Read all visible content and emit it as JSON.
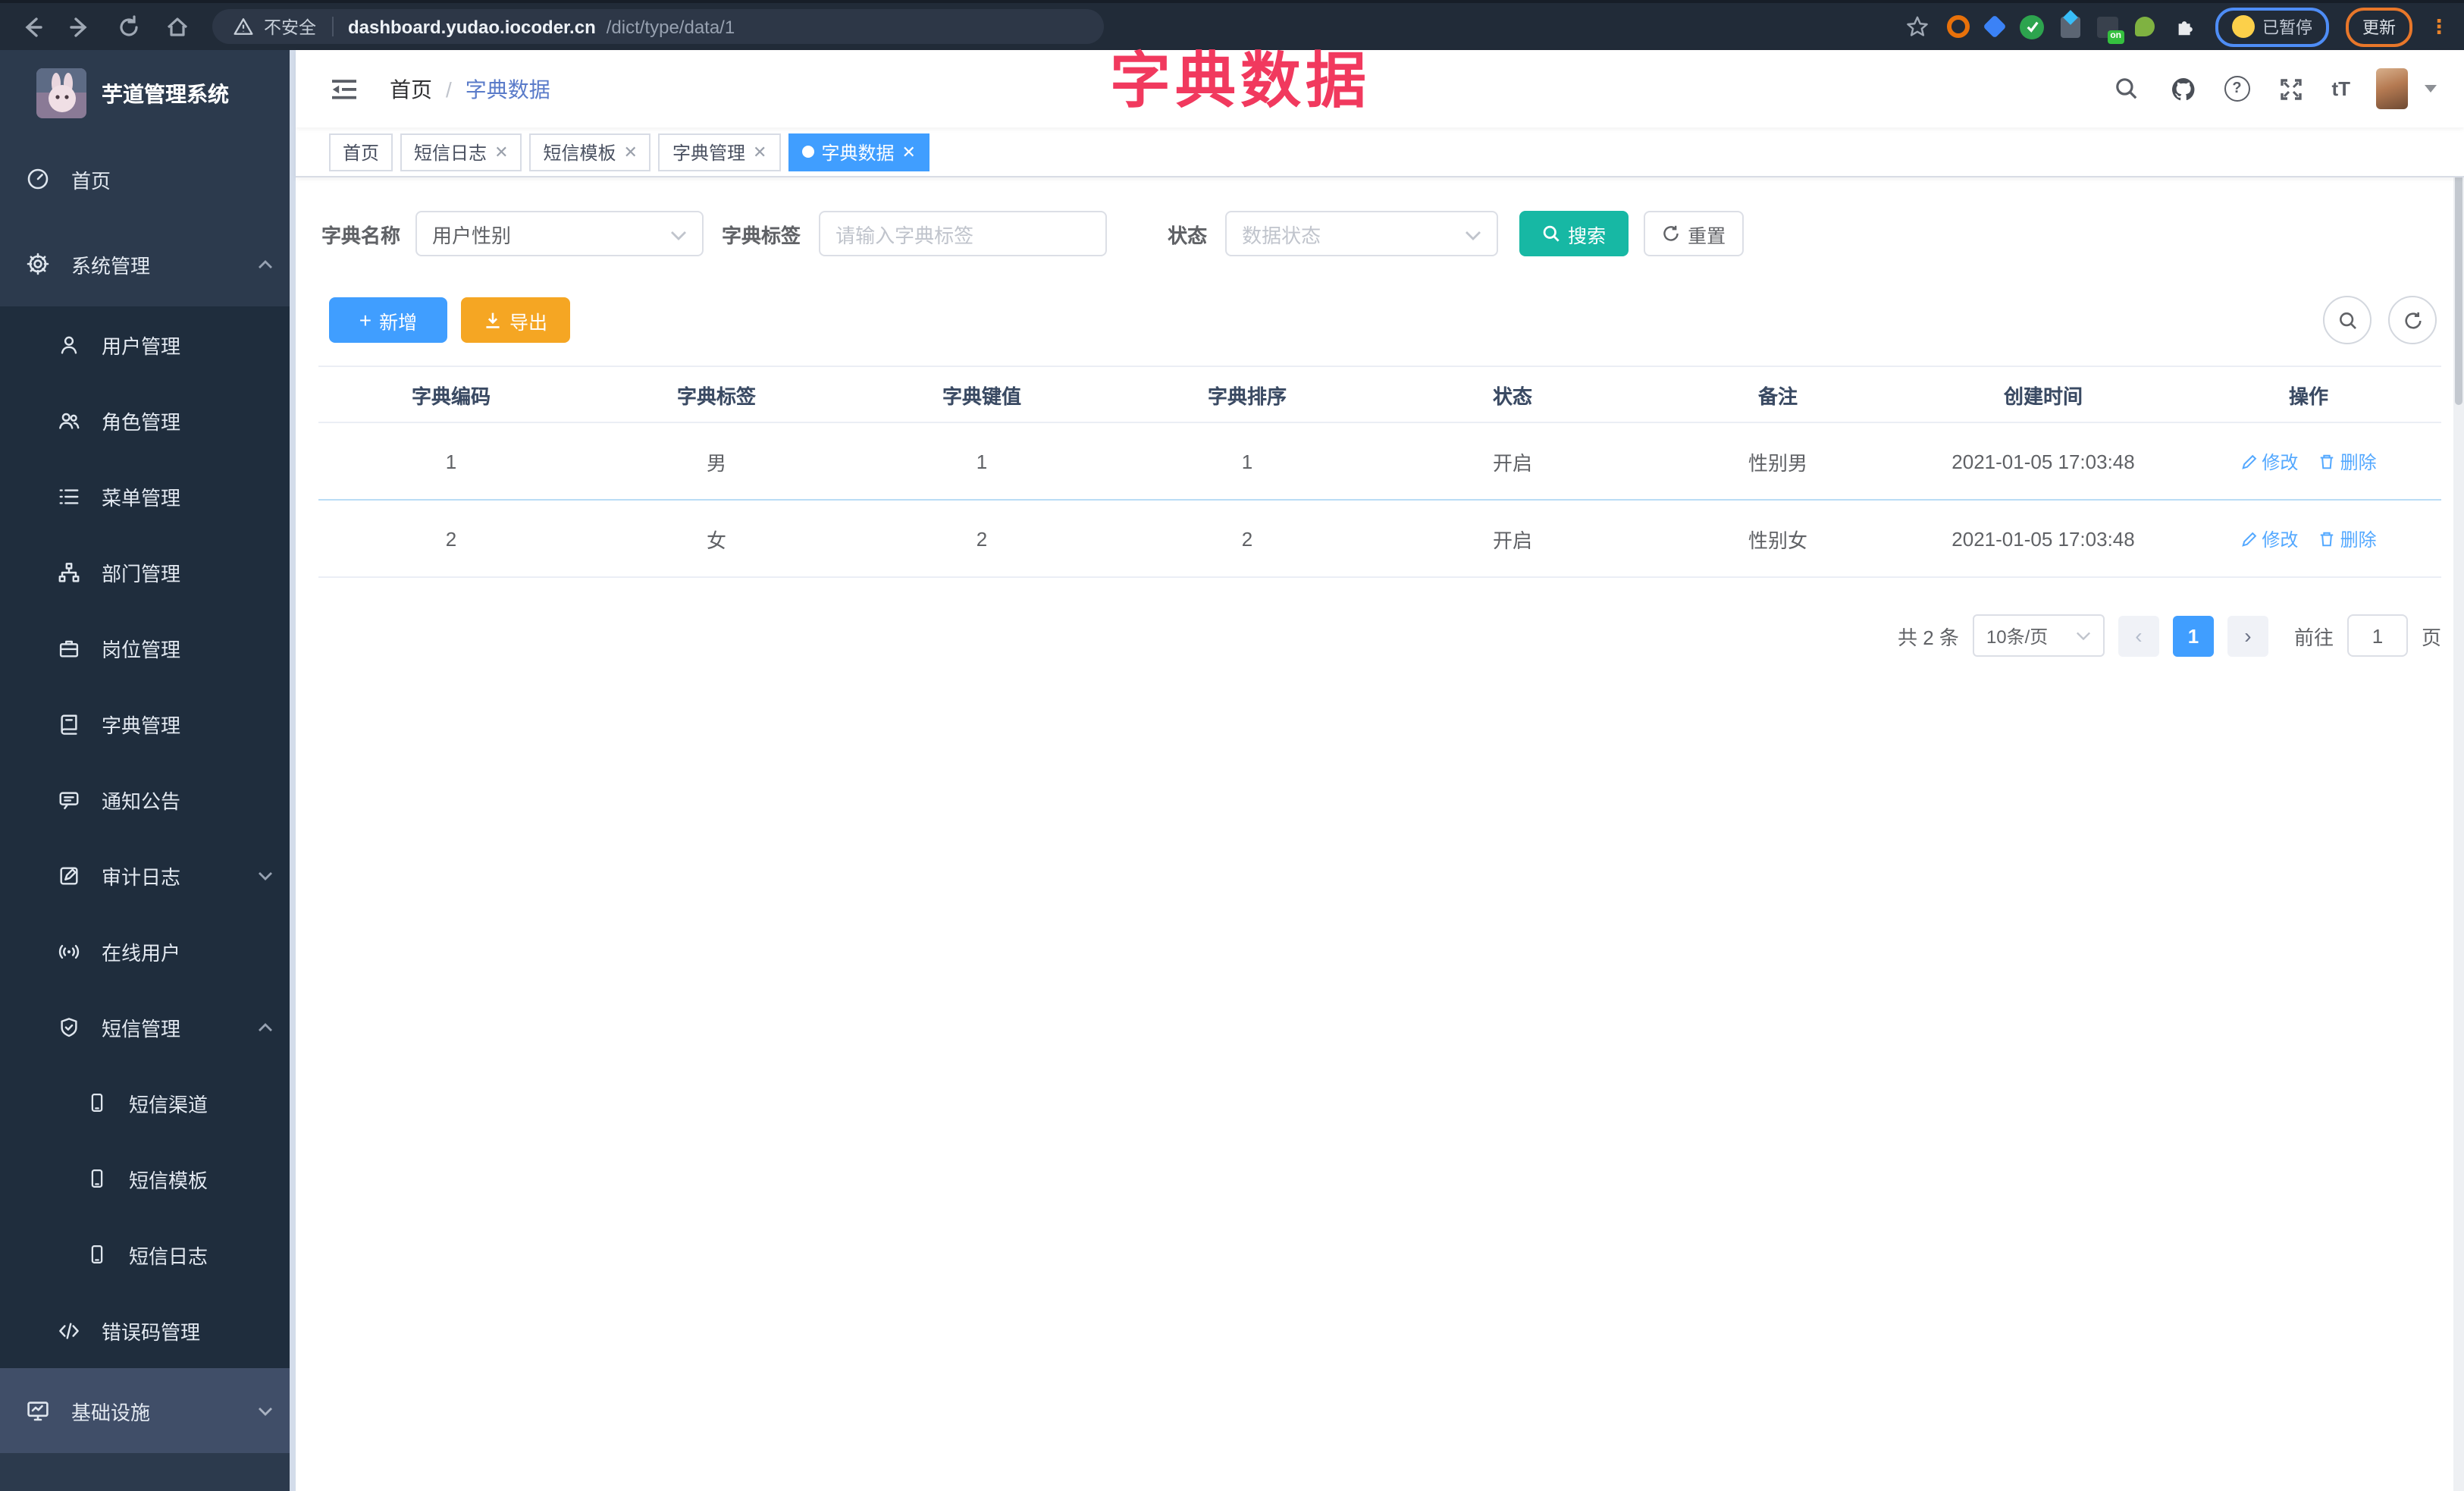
{
  "browser": {
    "security": "不安全",
    "domain": "dashboard.yudao.iocoder.cn",
    "path": "/dict/type/data/1",
    "ext_on_badge": "on",
    "profile_status": "已暂停",
    "update": "更新"
  },
  "overlay": {
    "title": "字典数据"
  },
  "sidebar": {
    "title": "芋道管理系统",
    "items": [
      {
        "label": "首页"
      },
      {
        "label": "系统管理"
      },
      {
        "label": "用户管理"
      },
      {
        "label": "角色管理"
      },
      {
        "label": "菜单管理"
      },
      {
        "label": "部门管理"
      },
      {
        "label": "岗位管理"
      },
      {
        "label": "字典管理"
      },
      {
        "label": "通知公告"
      },
      {
        "label": "审计日志"
      },
      {
        "label": "在线用户"
      },
      {
        "label": "短信管理"
      },
      {
        "label": "短信渠道"
      },
      {
        "label": "短信模板"
      },
      {
        "label": "短信日志"
      },
      {
        "label": "错误码管理"
      },
      {
        "label": "基础设施"
      }
    ]
  },
  "nav": {
    "breadcrumb_home": "首页",
    "breadcrumb_sep": "/",
    "breadcrumb_current": "字典数据"
  },
  "tabs": {
    "items": [
      {
        "label": "首页"
      },
      {
        "label": "短信日志"
      },
      {
        "label": "短信模板"
      },
      {
        "label": "字典管理"
      },
      {
        "label": "字典数据"
      }
    ]
  },
  "filters": {
    "name_label": "字典名称",
    "name_value": "用户性别",
    "tag_label": "字典标签",
    "tag_placeholder": "请输入字典标签",
    "status_label": "状态",
    "status_placeholder": "数据状态",
    "search": "搜索",
    "reset": "重置"
  },
  "toolbar": {
    "add": "新增",
    "export": "导出"
  },
  "table": {
    "columns": [
      "字典编码",
      "字典标签",
      "字典键值",
      "字典排序",
      "状态",
      "备注",
      "创建时间",
      "操作"
    ],
    "rows": [
      {
        "cells": [
          "1",
          "男",
          "1",
          "1",
          "开启",
          "性别男",
          "2021-01-05 17:03:48"
        ]
      },
      {
        "cells": [
          "2",
          "女",
          "2",
          "2",
          "开启",
          "性别女",
          "2021-01-05 17:03:48"
        ]
      }
    ],
    "op_edit": "修改",
    "op_delete": "删除"
  },
  "pagination": {
    "total": "共 2 条",
    "size": "10条/页",
    "page": "1",
    "goto": "前往",
    "goto_value": "1",
    "unit": "页"
  },
  "colors": {
    "accent": "#409eff",
    "teal": "#17b8a4",
    "orange": "#f5a623",
    "annotation": "#f1395e"
  }
}
